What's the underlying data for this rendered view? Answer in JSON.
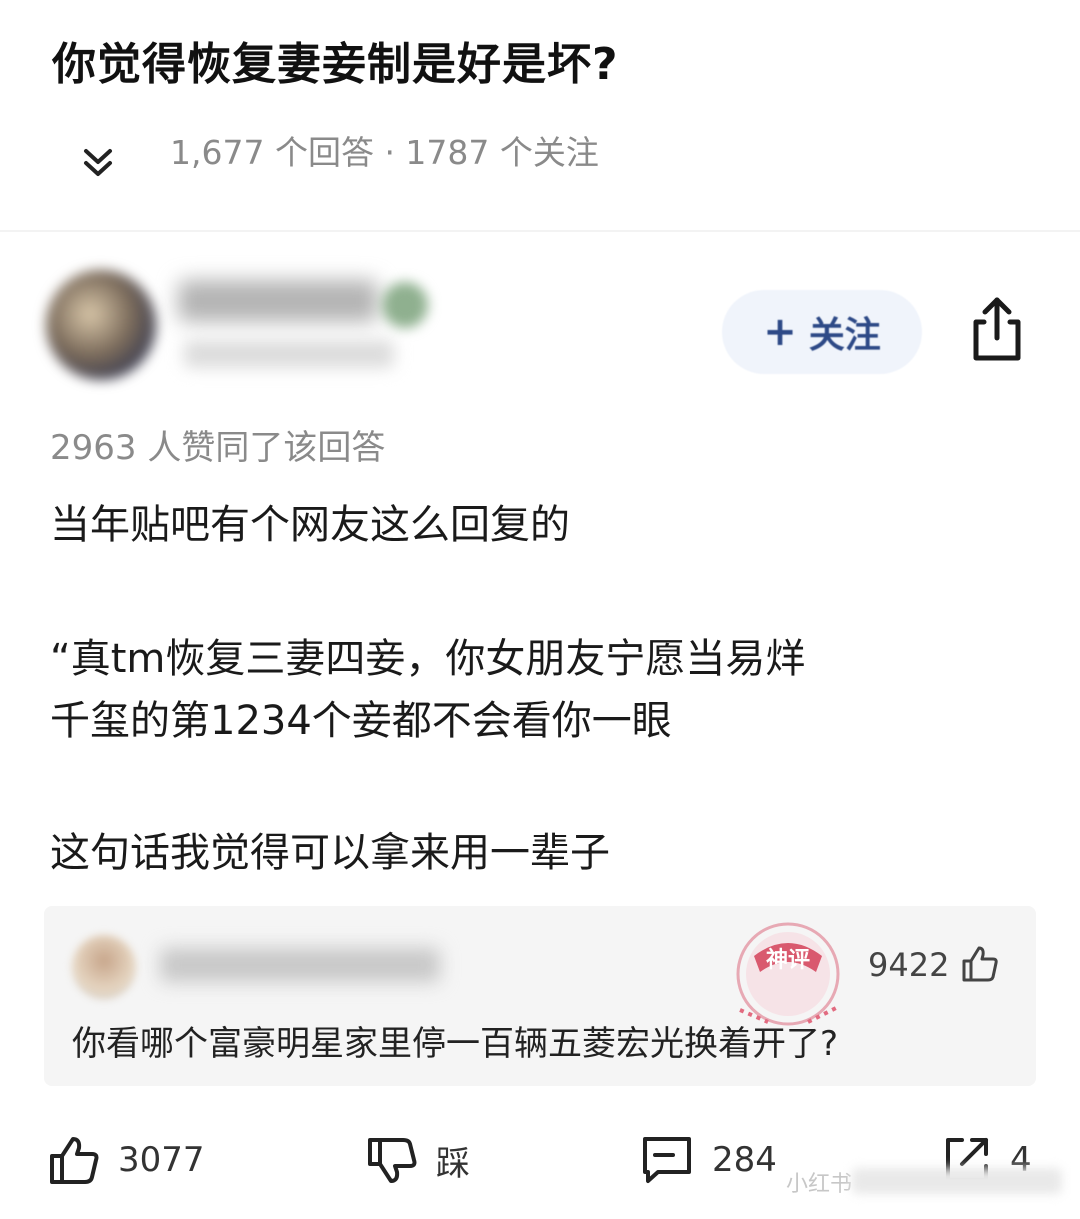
{
  "question": {
    "title": "你觉得恢复妻妾制是好是坏?",
    "meta": "1,677 个回答 · 1787 个关注"
  },
  "answer": {
    "follow_label": "关注",
    "agree_text": "2963 人赞同了该回答",
    "lines": [
      "当年贴吧有个网友这么回复的",
      "“真tm恢复三妻四妾，你女朋友宁愿当易烊",
      "千玺的第1234个妾都不会看你一眼",
      "这句话我觉得可以拿来用一辈子"
    ]
  },
  "top_comment": {
    "stamp_label": "神评",
    "likes": "9422",
    "text": "你看哪个富豪明星家里停一百辆五菱宏光换着开了?"
  },
  "action_bar": {
    "like_count": "3077",
    "dislike_label": "踩",
    "comment_count": "284",
    "forward_count": "4"
  },
  "watermark": "小红书",
  "colors": {
    "follow_text": "#2e4a87",
    "follow_bg": "#f0f4fb",
    "stamp": "#d9596e"
  }
}
